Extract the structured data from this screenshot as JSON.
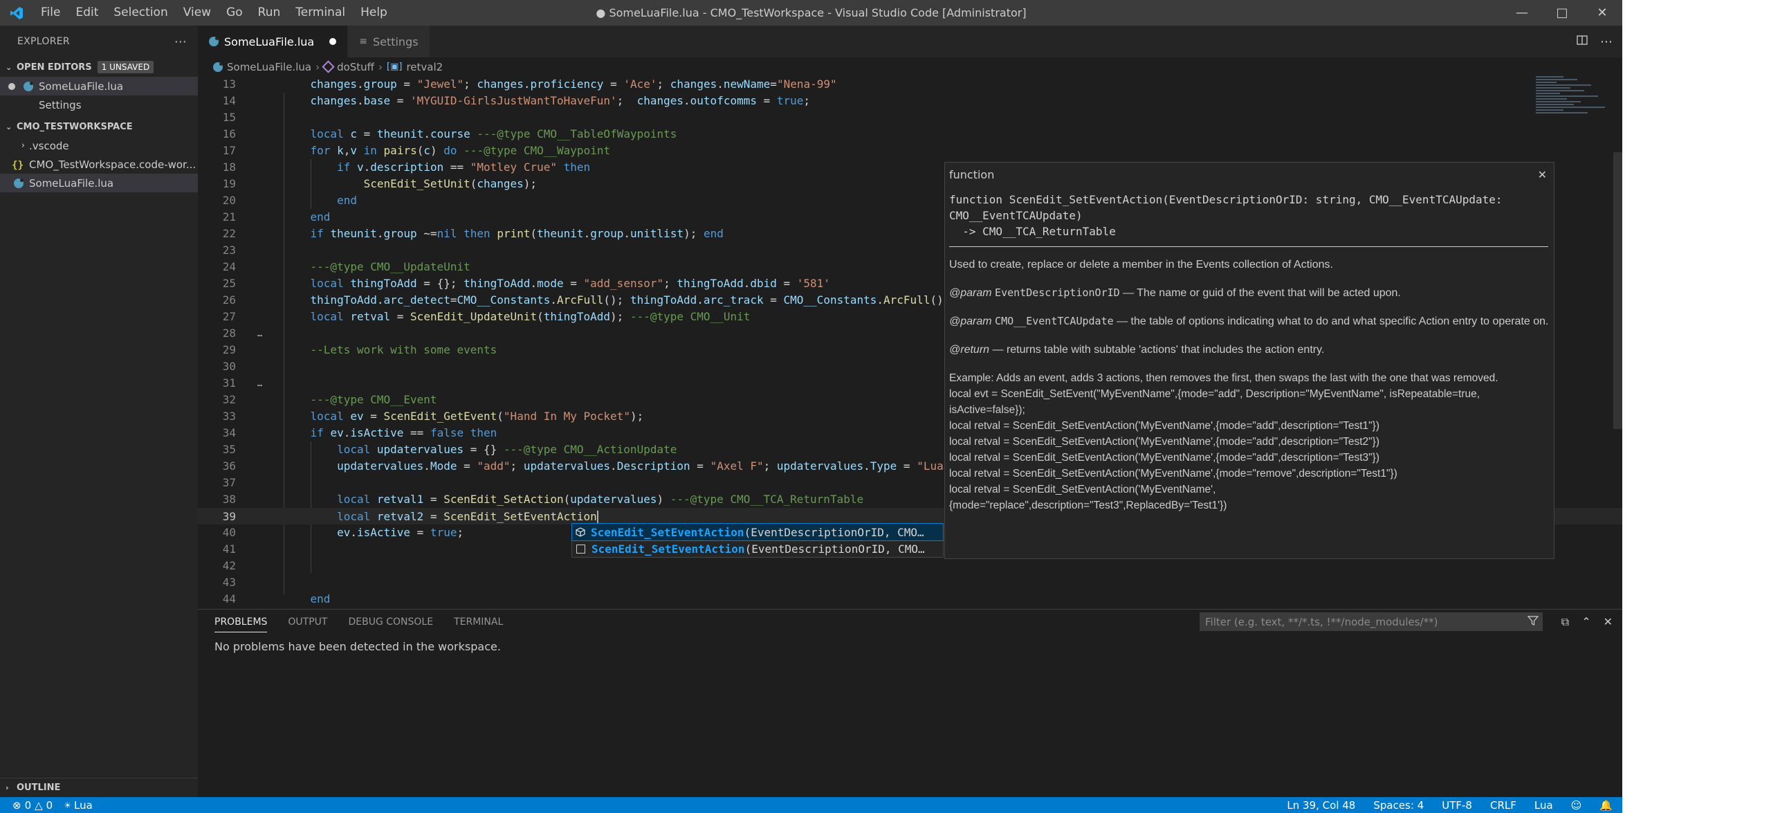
{
  "window": {
    "title": "● SomeLuaFile.lua - CMO_TestWorkspace - Visual Studio Code [Administrator]",
    "menu": [
      "File",
      "Edit",
      "Selection",
      "View",
      "Go",
      "Run",
      "Terminal",
      "Help"
    ]
  },
  "sidebar": {
    "title": "EXPLORER",
    "open_editors": {
      "label": "OPEN EDITORS",
      "badge": "1 UNSAVED",
      "items": [
        "SomeLuaFile.lua",
        "Settings"
      ]
    },
    "workspace": {
      "label": "CMO_TESTWORKSPACE",
      "items": [
        ".vscode",
        "CMO_TestWorkspace.code-wor...",
        "SomeLuaFile.lua"
      ]
    },
    "outline": "OUTLINE"
  },
  "tabs": [
    {
      "label": "SomeLuaFile.lua",
      "active": true,
      "modified": true
    },
    {
      "label": "Settings",
      "active": false
    }
  ],
  "breadcrumb": [
    "SomeLuaFile.lua",
    "doStuff",
    "retval2"
  ],
  "editor": {
    "line_numbers": [
      "13",
      "14",
      "15",
      "16",
      "17",
      "18",
      "19",
      "20",
      "21",
      "22",
      "23",
      "24",
      "25",
      "26",
      "27",
      "28",
      "29",
      "30",
      "31",
      "32",
      "33",
      "34",
      "35",
      "36",
      "37",
      "38",
      "39",
      "40",
      "41",
      "42",
      "43",
      "44"
    ],
    "current_line": "39"
  },
  "suggest": {
    "items": [
      {
        "match": "ScenEdit_SetEventAction",
        "rest": "(EventDescriptionOrID, CMO…"
      },
      {
        "match": "ScenEdit_SetEventAction",
        "rest": "(EventDescriptionOrID, CMO…"
      }
    ]
  },
  "hover": {
    "kind": "function",
    "signature_1": "function ScenEdit_SetEventAction(EventDescriptionOrID: string, CMO__EventTCAUpdate:",
    "signature_2": "CMO__EventTCAUpdate)",
    "signature_3": "  -> CMO__TCA_ReturnTable",
    "description": "Used to create, replace or delete a member in the Events collection of Actions.",
    "param1_tag": "@param",
    "param1_name": "EventDescriptionOrID",
    "param1_text": " — The name or guid of the event that will be acted upon.",
    "param2_tag": "@param",
    "param2_name": "CMO__EventTCAUpdate",
    "param2_text": " — the table of options indicating what to do and what specific Action entry to operate on.",
    "return_tag": "@return",
    "return_text": " — returns table with subtable 'actions' that includes the action entry.",
    "example_lines": [
      "Example: Adds an event, adds 3 actions, then removes the first, then swaps the last with the one that was removed.",
      "local evt = ScenEdit_SetEvent(\"MyEventName\",{mode=\"add\", Description=\"MyEventName\", isRepeatable=true, isActive=false});",
      "local retval = ScenEdit_SetEventAction('MyEventName',{mode=\"add\",description=\"Test1\"})",
      "local retval = ScenEdit_SetEventAction('MyEventName',{mode=\"add\",description=\"Test2\"})",
      "local retval = ScenEdit_SetEventAction('MyEventName',{mode=\"add\",description=\"Test3\"})",
      "local retval = ScenEdit_SetEventAction('MyEventName',{mode=\"remove\",description=\"Test1\"})",
      "local retval = ScenEdit_SetEventAction('MyEventName',",
      "{mode=\"replace\",description=\"Test3\",ReplacedBy='Test1'})"
    ]
  },
  "panel": {
    "tabs": [
      "PROBLEMS",
      "OUTPUT",
      "DEBUG CONSOLE",
      "TERMINAL"
    ],
    "filter_placeholder": "Filter (e.g. text, **/*.ts, !**/node_modules/**)",
    "message": "No problems have been detected in the workspace."
  },
  "statusbar": {
    "errors": "0",
    "warnings": "0",
    "language_left": "Lua",
    "position": "Ln 39, Col 48",
    "spaces": "Spaces: 4",
    "encoding": "UTF-8",
    "eol": "CRLF",
    "language": "Lua"
  },
  "colors": {
    "accent": "#007acc",
    "titlebar": "#3c3c3c",
    "sidebar": "#252526",
    "editor": "#1e1e1e"
  }
}
